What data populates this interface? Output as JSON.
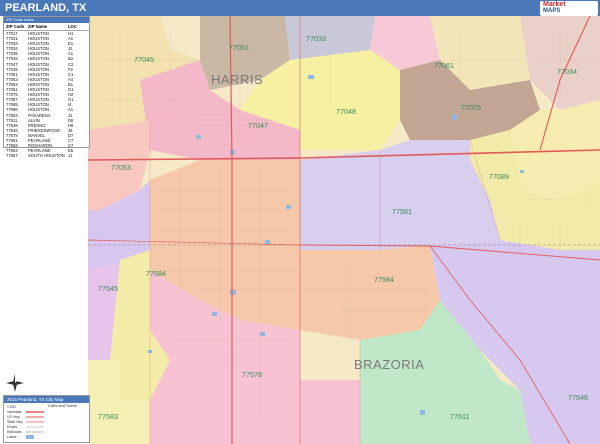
{
  "title": "PEARLAND, TX",
  "logo": {
    "line1": "Market",
    "line2": "MAPS"
  },
  "index": {
    "header": "ZIP Code Index",
    "columns": [
      "ZIP Code",
      "ZIP Name",
      "LOC"
    ],
    "rows": [
      [
        "77017",
        "HOUSTON",
        "H1"
      ],
      [
        "77021",
        "HOUSTON",
        "A1"
      ],
      [
        "77033",
        "HOUSTON",
        "E1"
      ],
      [
        "77034",
        "HOUSTON",
        "J2"
      ],
      [
        "77035",
        "HOUSTON",
        "A1"
      ],
      [
        "77045",
        "HOUSTON",
        "B2"
      ],
      [
        "77047",
        "HOUSTON",
        "C2"
      ],
      [
        "77048",
        "HOUSTON",
        "F2"
      ],
      [
        "77051",
        "HOUSTON",
        "C1"
      ],
      [
        "77053",
        "HOUSTON",
        "A4"
      ],
      [
        "77054",
        "HOUSTON",
        "B1"
      ],
      [
        "77061",
        "HOUSTON",
        "G1"
      ],
      [
        "77075",
        "HOUSTON",
        "H2"
      ],
      [
        "77087",
        "HOUSTON",
        "G1"
      ],
      [
        "77089",
        "HOUSTON",
        "I4"
      ],
      [
        "77096",
        "HOUSTON",
        "A1"
      ],
      [
        "77504",
        "PASADENA",
        "J1"
      ],
      [
        "77511",
        "ALVIN",
        "D8"
      ],
      [
        "77545",
        "FRESNO",
        "H6"
      ],
      [
        "77546",
        "FRIENDSWOOD",
        "J6"
      ],
      [
        "77578",
        "MANVEL",
        "D7"
      ],
      [
        "77581",
        "PEARLAND",
        "C7"
      ],
      [
        "77583",
        "ROSHARON",
        "C7"
      ],
      [
        "77584",
        "PEARLAND",
        "E5"
      ],
      [
        "77587",
        "SOUTH HOUSTON",
        "J1"
      ]
    ]
  },
  "legend": {
    "header": "2015 Pearland, TX City Map",
    "title": "Cities and Towns",
    "items": [
      "1,000",
      "Interstate",
      "US Hwy",
      "State Hwy",
      "Roads",
      "Railroads",
      "Lakes"
    ]
  },
  "counties": [
    {
      "name": "HARRIS"
    },
    {
      "name": "BRAZORIA"
    }
  ],
  "zips": [
    "77051",
    "77033",
    "77061",
    "77034",
    "77045",
    "77047",
    "77048",
    "77075",
    "77053",
    "77089",
    "77581",
    "77584",
    "77545",
    "77578",
    "77583",
    "77511",
    "77546"
  ],
  "colors": {
    "title_bar": "#4a78b8",
    "zip_label": "#3a8a5a",
    "highway": "#e05a5a",
    "county_line": "#7a7a7a"
  }
}
